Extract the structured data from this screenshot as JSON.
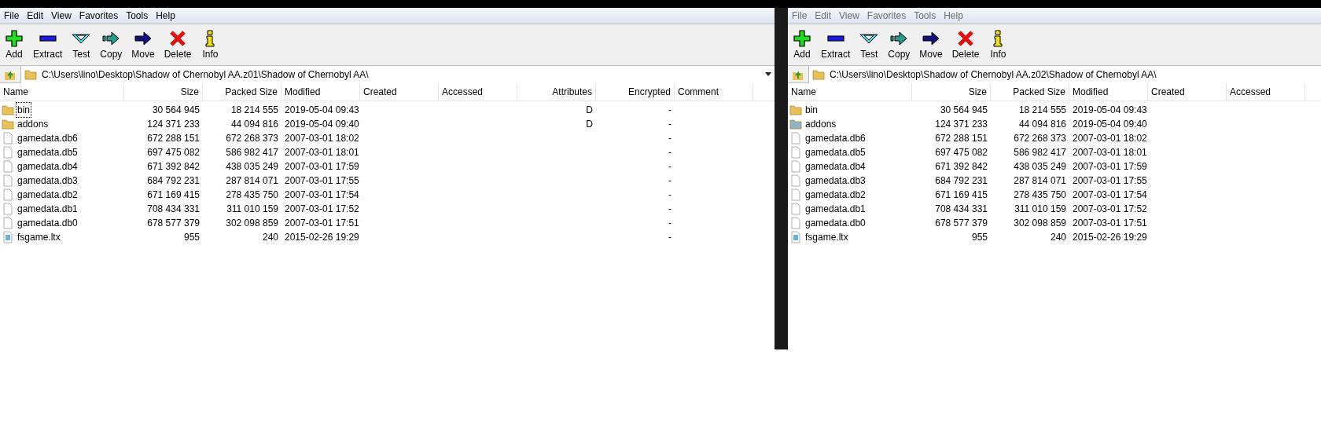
{
  "windows": [
    {
      "active": true,
      "menu": [
        "File",
        "Edit",
        "View",
        "Favorites",
        "Tools",
        "Help"
      ],
      "toolbar": [
        {
          "kind": "add",
          "label": "Add"
        },
        {
          "kind": "extract",
          "label": "Extract"
        },
        {
          "kind": "test",
          "label": "Test"
        },
        {
          "kind": "copy",
          "label": "Copy"
        },
        {
          "kind": "move",
          "label": "Move"
        },
        {
          "kind": "delete",
          "label": "Delete"
        },
        {
          "kind": "info",
          "label": "Info"
        }
      ],
      "address": "C:\\Users\\lino\\Desktop\\Shadow of Chernobyl AA.z01\\Shadow of Chernobyl AA\\",
      "columns": [
        "Name",
        "Size",
        "Packed Size",
        "Modified",
        "Created",
        "Accessed",
        "Attributes",
        "Encrypted",
        "Comment"
      ],
      "rows": [
        {
          "kind": "folder",
          "focused": true,
          "cells": [
            "bin",
            "30 564 945",
            "18 214 555",
            "2019-05-04 09:43",
            "",
            "",
            "D",
            "-",
            ""
          ]
        },
        {
          "kind": "folder",
          "focused": false,
          "cells": [
            "addons",
            "124 371 233",
            "44 094 816",
            "2019-05-04 09:40",
            "",
            "",
            "D",
            "-",
            ""
          ]
        },
        {
          "kind": "file",
          "focused": false,
          "cells": [
            "gamedata.db6",
            "672 288 151",
            "672 268 373",
            "2007-03-01 18:02",
            "",
            "",
            "",
            "-",
            ""
          ]
        },
        {
          "kind": "file",
          "focused": false,
          "cells": [
            "gamedata.db5",
            "697 475 082",
            "586 982 417",
            "2007-03-01 18:01",
            "",
            "",
            "",
            "-",
            ""
          ]
        },
        {
          "kind": "file",
          "focused": false,
          "cells": [
            "gamedata.db4",
            "671 392 842",
            "438 035 249",
            "2007-03-01 17:59",
            "",
            "",
            "",
            "-",
            ""
          ]
        },
        {
          "kind": "file",
          "focused": false,
          "cells": [
            "gamedata.db3",
            "684 792 231",
            "287 814 071",
            "2007-03-01 17:55",
            "",
            "",
            "",
            "-",
            ""
          ]
        },
        {
          "kind": "file",
          "focused": false,
          "cells": [
            "gamedata.db2",
            "671 169 415",
            "278 435 750",
            "2007-03-01 17:54",
            "",
            "",
            "",
            "-",
            ""
          ]
        },
        {
          "kind": "file",
          "focused": false,
          "cells": [
            "gamedata.db1",
            "708 434 331",
            "311 010 159",
            "2007-03-01 17:52",
            "",
            "",
            "",
            "-",
            ""
          ]
        },
        {
          "kind": "file",
          "focused": false,
          "cells": [
            "gamedata.db0",
            "678 577 379",
            "302 098 859",
            "2007-03-01 17:51",
            "",
            "",
            "",
            "-",
            ""
          ]
        },
        {
          "kind": "text-file",
          "focused": false,
          "cells": [
            "fsgame.ltx",
            "955",
            "240",
            "2015-02-26 19:29",
            "",
            "",
            "",
            "-",
            ""
          ]
        }
      ]
    },
    {
      "active": false,
      "menu": [
        "File",
        "Edit",
        "View",
        "Favorites",
        "Tools",
        "Help"
      ],
      "toolbar": [
        {
          "kind": "add",
          "label": "Add"
        },
        {
          "kind": "extract",
          "label": "Extract"
        },
        {
          "kind": "test",
          "label": "Test"
        },
        {
          "kind": "copy",
          "label": "Copy"
        },
        {
          "kind": "move",
          "label": "Move"
        },
        {
          "kind": "delete",
          "label": "Delete"
        },
        {
          "kind": "info",
          "label": "Info"
        }
      ],
      "address": "C:\\Users\\lino\\Desktop\\Shadow of Chernobyl AA.z02\\Shadow of Chernobyl AA\\",
      "columns": [
        "Name",
        "Size",
        "Packed Size",
        "Modified",
        "Created",
        "Accessed"
      ],
      "rows": [
        {
          "kind": "folder",
          "focused": false,
          "cells": [
            "bin",
            "30 564 945",
            "18 214 555",
            "2019-05-04 09:43",
            "",
            ""
          ]
        },
        {
          "kind": "shared-folder",
          "focused": false,
          "cells": [
            "addons",
            "124 371 233",
            "44 094 816",
            "2019-05-04 09:40",
            "",
            ""
          ]
        },
        {
          "kind": "file",
          "focused": false,
          "cells": [
            "gamedata.db6",
            "672 288 151",
            "672 268 373",
            "2007-03-01 18:02",
            "",
            ""
          ]
        },
        {
          "kind": "file",
          "focused": false,
          "cells": [
            "gamedata.db5",
            "697 475 082",
            "586 982 417",
            "2007-03-01 18:01",
            "",
            ""
          ]
        },
        {
          "kind": "file",
          "focused": false,
          "cells": [
            "gamedata.db4",
            "671 392 842",
            "438 035 249",
            "2007-03-01 17:59",
            "",
            ""
          ]
        },
        {
          "kind": "file",
          "focused": false,
          "cells": [
            "gamedata.db3",
            "684 792 231",
            "287 814 071",
            "2007-03-01 17:55",
            "",
            ""
          ]
        },
        {
          "kind": "file",
          "focused": false,
          "cells": [
            "gamedata.db2",
            "671 169 415",
            "278 435 750",
            "2007-03-01 17:54",
            "",
            ""
          ]
        },
        {
          "kind": "file",
          "focused": false,
          "cells": [
            "gamedata.db1",
            "708 434 331",
            "311 010 159",
            "2007-03-01 17:52",
            "",
            ""
          ]
        },
        {
          "kind": "file",
          "focused": false,
          "cells": [
            "gamedata.db0",
            "678 577 379",
            "302 098 859",
            "2007-03-01 17:51",
            "",
            ""
          ]
        },
        {
          "kind": "text-file",
          "focused": false,
          "cells": [
            "fsgame.ltx",
            "955",
            "240",
            "2015-02-26 19:29",
            "",
            ""
          ]
        }
      ]
    }
  ]
}
